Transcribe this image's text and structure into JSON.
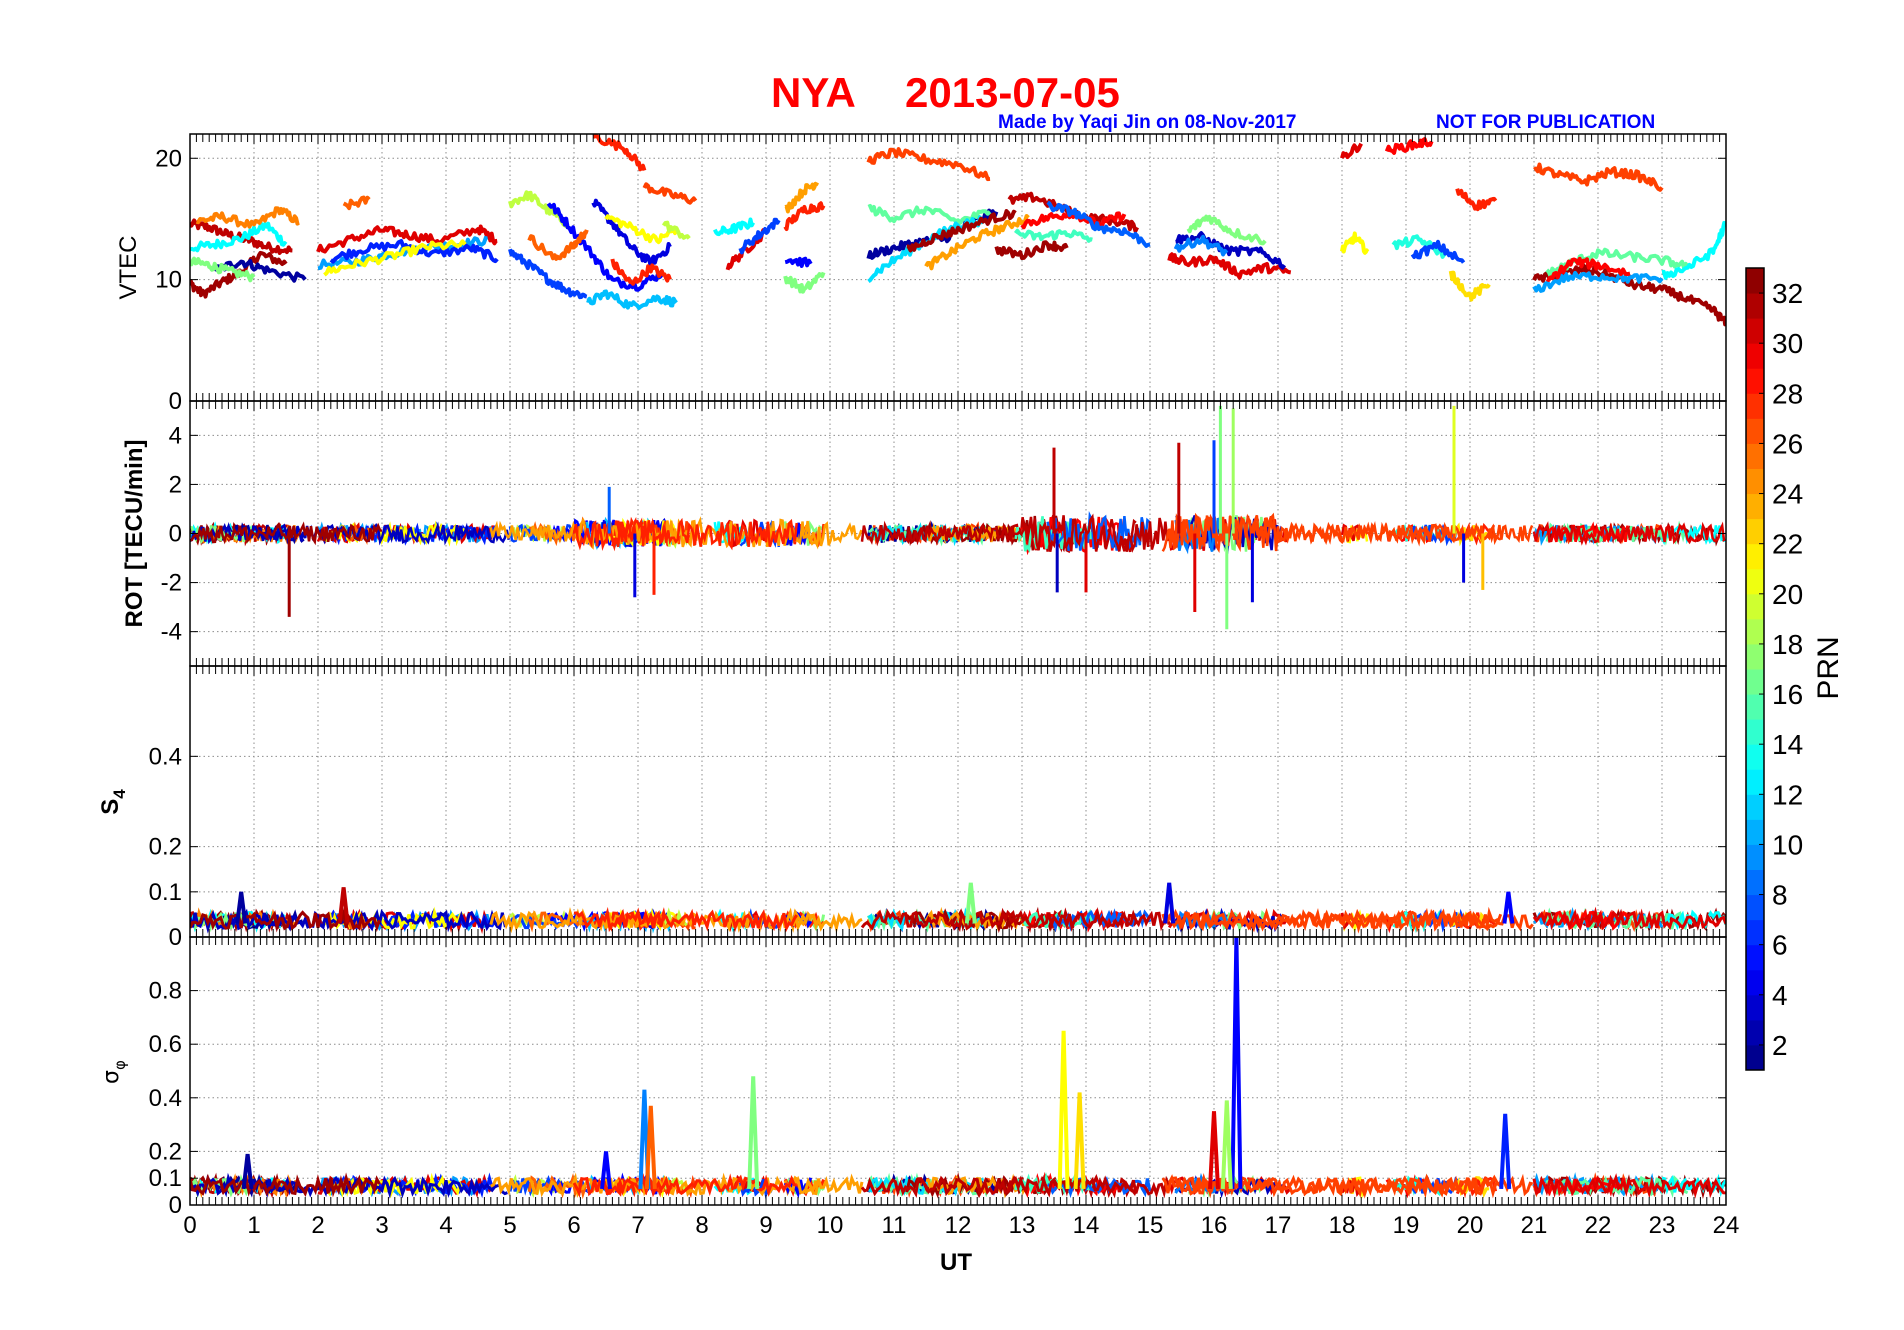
{
  "figure": {
    "title_station": "NYA",
    "title_date": "2013-07-05",
    "credit": "Made by Yaqi Jin on 08-Nov-2017",
    "notice": "NOT FOR PUBLICATION",
    "xlabel": "UT",
    "colorbar_label": "PRN",
    "colors": {
      "title": "#ff0000",
      "credit": "#0000ff",
      "axes": "#000000",
      "grid": "#8c8c8c"
    }
  },
  "chart_data": [
    {
      "type": "line",
      "panel": "VTEC",
      "ylabel": "VTEC",
      "xlim": [
        0,
        24
      ],
      "ylim": [
        0,
        22
      ],
      "yticks": [
        0,
        10,
        20
      ],
      "xticks": [
        0,
        1,
        2,
        3,
        4,
        5,
        6,
        7,
        8,
        9,
        10,
        11,
        12,
        13,
        14,
        15,
        16,
        17,
        18,
        19,
        20,
        21,
        22,
        23,
        24
      ],
      "grid": true,
      "series_summary": "one trace per PRN (1-32), coloured by PRN",
      "segments": [
        {
          "prn": 31,
          "x": [
            0.0,
            0.3,
            0.6,
            0.9,
            1.2,
            1.6
          ],
          "y": [
            14.6,
            14.3,
            13.7,
            13.3,
            12.7,
            12.4
          ]
        },
        {
          "prn": 32,
          "x": [
            0.0,
            0.2,
            0.5,
            0.8,
            1.1,
            1.5
          ],
          "y": [
            9.7,
            8.8,
            9.8,
            10.6,
            12.1,
            11.3
          ]
        },
        {
          "prn": 13,
          "x": [
            0.0,
            0.4,
            0.8,
            1.2,
            1.5
          ],
          "y": [
            12.6,
            12.9,
            13.4,
            14.5,
            12.9
          ]
        },
        {
          "prn": 25,
          "x": [
            0.1,
            0.5,
            1.0,
            1.4,
            1.7
          ],
          "y": [
            14.8,
            15.2,
            14.4,
            15.8,
            14.7
          ]
        },
        {
          "prn": 2,
          "x": [
            0.4,
            0.8,
            1.2,
            1.8
          ],
          "y": [
            10.8,
            11.5,
            10.8,
            10.0
          ]
        },
        {
          "prn": 17,
          "x": [
            0.0,
            0.3,
            0.6,
            1.0
          ],
          "y": [
            11.5,
            11.2,
            10.7,
            10.2
          ]
        },
        {
          "prn": 10,
          "x": [
            2.0,
            2.6,
            3.1,
            3.6,
            4.2,
            4.7
          ],
          "y": [
            11.2,
            11.5,
            12.1,
            12.6,
            12.9,
            13.3
          ]
        },
        {
          "prn": 30,
          "x": [
            2.0,
            2.5,
            3.0,
            3.4,
            3.9,
            4.5,
            4.8
          ],
          "y": [
            12.4,
            13.3,
            14.1,
            13.7,
            13.2,
            14.2,
            13.2
          ]
        },
        {
          "prn": 6,
          "x": [
            2.2,
            2.7,
            3.3,
            3.8,
            4.4,
            4.8
          ],
          "y": [
            11.7,
            12.5,
            12.9,
            12.1,
            12.6,
            11.7
          ]
        },
        {
          "prn": 21,
          "x": [
            2.1,
            2.6,
            3.2,
            3.7,
            4.3
          ],
          "y": [
            10.6,
            11.3,
            12.0,
            12.7,
            12.9
          ]
        },
        {
          "prn": 26,
          "x": [
            2.4,
            2.8
          ],
          "y": [
            16.0,
            16.6
          ]
        },
        {
          "prn": 19,
          "x": [
            5.0,
            5.3,
            5.6,
            5.9
          ],
          "y": [
            16.3,
            17.0,
            15.7,
            14.6
          ]
        },
        {
          "prn": 7,
          "x": [
            5.0,
            5.3,
            5.6,
            5.9,
            6.2
          ],
          "y": [
            12.3,
            11.2,
            10.0,
            9.1,
            8.6
          ]
        },
        {
          "prn": 5,
          "x": [
            5.6,
            5.9,
            6.3,
            6.6,
            7.0,
            7.4
          ],
          "y": [
            16.4,
            14.6,
            12.0,
            9.9,
            9.5,
            10.6
          ]
        },
        {
          "prn": 26,
          "x": [
            5.3,
            5.7,
            6.0,
            6.2
          ],
          "y": [
            13.5,
            11.7,
            12.8,
            14.1
          ]
        },
        {
          "prn": 11,
          "x": [
            6.2,
            6.5,
            6.9,
            7.3,
            7.6
          ],
          "y": [
            8.0,
            8.9,
            7.8,
            8.5,
            8.1
          ]
        },
        {
          "prn": 4,
          "x": [
            6.3,
            6.6,
            6.9,
            7.2,
            7.5
          ],
          "y": [
            16.4,
            14.7,
            12.6,
            11.4,
            12.7
          ]
        },
        {
          "prn": 21,
          "x": [
            6.5,
            6.9,
            7.3,
            7.6
          ],
          "y": [
            15.2,
            14.3,
            13.2,
            14.2
          ]
        },
        {
          "prn": 28,
          "x": [
            6.6,
            6.9,
            7.2,
            7.5
          ],
          "y": [
            11.4,
            9.6,
            11.0,
            10.0
          ]
        },
        {
          "prn": 28,
          "x": [
            6.3,
            6.8,
            7.1
          ],
          "y": [
            21.8,
            20.8,
            19.0
          ]
        },
        {
          "prn": 27,
          "x": [
            7.1,
            7.5,
            7.9
          ],
          "y": [
            17.7,
            17.0,
            16.5
          ]
        },
        {
          "prn": 19,
          "x": [
            7.4,
            7.8
          ],
          "y": [
            14.6,
            13.4
          ]
        },
        {
          "prn": 13,
          "x": [
            8.2,
            8.5,
            8.8
          ],
          "y": [
            13.8,
            14.2,
            14.7
          ]
        },
        {
          "prn": 30,
          "x": [
            8.4,
            8.7,
            9.0
          ],
          "y": [
            11.1,
            12.5,
            14.0
          ]
        },
        {
          "prn": 7,
          "x": [
            8.6,
            8.9,
            9.2
          ],
          "y": [
            12.5,
            13.7,
            14.9
          ]
        },
        {
          "prn": 17,
          "x": [
            9.3,
            9.6,
            9.9
          ],
          "y": [
            10.2,
            9.1,
            10.6
          ]
        },
        {
          "prn": 28,
          "x": [
            9.3,
            9.6,
            9.9
          ],
          "y": [
            14.4,
            15.8,
            16.1
          ]
        },
        {
          "prn": 24,
          "x": [
            9.3,
            9.6,
            9.8
          ],
          "y": [
            15.7,
            17.4,
            18.0
          ]
        },
        {
          "prn": 5,
          "x": [
            9.3,
            9.7
          ],
          "y": [
            11.7,
            11.3
          ]
        },
        {
          "prn": 27,
          "x": [
            10.6,
            11.0,
            11.5,
            12.0,
            12.5
          ],
          "y": [
            19.8,
            20.5,
            19.9,
            19.5,
            18.3
          ]
        },
        {
          "prn": 2,
          "x": [
            10.6,
            11.0,
            11.4,
            11.8,
            12.2,
            12.6
          ],
          "y": [
            12.0,
            12.6,
            13.1,
            13.4,
            14.7,
            15.6
          ]
        },
        {
          "prn": 16,
          "x": [
            10.6,
            11.0,
            11.5,
            12.0,
            12.5
          ],
          "y": [
            15.9,
            15.1,
            15.8,
            14.8,
            15.6
          ]
        },
        {
          "prn": 12,
          "x": [
            10.6,
            11.0,
            11.5,
            12.0,
            12.4
          ],
          "y": [
            10.2,
            11.6,
            13.2,
            14.5,
            14.9
          ]
        },
        {
          "prn": 32,
          "x": [
            11.2,
            11.6,
            12.0,
            12.5,
            12.9
          ],
          "y": [
            12.4,
            13.4,
            14.1,
            15.0,
            15.5
          ]
        },
        {
          "prn": 24,
          "x": [
            11.5,
            11.9,
            12.3,
            12.7,
            13.1
          ],
          "y": [
            11.0,
            12.3,
            13.5,
            14.3,
            15.1
          ]
        },
        {
          "prn": 32,
          "x": [
            12.6,
            13.0,
            13.4,
            13.7
          ],
          "y": [
            12.5,
            12.0,
            12.9,
            12.6
          ]
        },
        {
          "prn": 31,
          "x": [
            12.8,
            13.2,
            13.6,
            14.0,
            14.4,
            14.8
          ],
          "y": [
            16.5,
            16.8,
            15.9,
            15.1,
            14.9,
            14.3
          ]
        },
        {
          "prn": 29,
          "x": [
            13.0,
            13.4,
            13.8,
            14.2,
            14.6
          ],
          "y": [
            14.6,
            15.1,
            15.5,
            14.5,
            15.4
          ]
        },
        {
          "prn": 15,
          "x": [
            12.9,
            13.3,
            13.7,
            14.1
          ],
          "y": [
            13.8,
            13.5,
            13.9,
            13.3
          ]
        },
        {
          "prn": 8,
          "x": [
            13.4,
            13.8,
            14.2,
            14.6,
            15.0
          ],
          "y": [
            16.1,
            15.6,
            14.3,
            14.0,
            12.9
          ]
        },
        {
          "prn": 30,
          "x": [
            15.3,
            15.6,
            16.0,
            16.4,
            16.8,
            17.2
          ],
          "y": [
            11.8,
            11.4,
            11.7,
            10.5,
            11.0,
            10.6
          ]
        },
        {
          "prn": 17,
          "x": [
            15.6,
            15.9,
            16.3,
            16.8
          ],
          "y": [
            14.0,
            15.2,
            13.9,
            13.2
          ]
        },
        {
          "prn": 3,
          "x": [
            15.4,
            15.8,
            16.2,
            16.7,
            17.1
          ],
          "y": [
            13.3,
            13.5,
            12.4,
            12.3,
            11.2
          ]
        },
        {
          "prn": 9,
          "x": [
            15.4,
            15.8,
            16.2
          ],
          "y": [
            12.6,
            13.3,
            12.2
          ]
        },
        {
          "prn": 21,
          "x": [
            18.0,
            18.2,
            18.4
          ],
          "y": [
            12.4,
            13.5,
            12.3
          ]
        },
        {
          "prn": 30,
          "x": [
            18.0,
            18.3
          ],
          "y": [
            20.0,
            21.2
          ]
        },
        {
          "prn": 29,
          "x": [
            18.7,
            19.1,
            19.4
          ],
          "y": [
            20.6,
            21.1,
            21.4
          ]
        },
        {
          "prn": 14,
          "x": [
            18.8,
            19.2,
            19.6
          ],
          "y": [
            12.8,
            13.3,
            12.1
          ]
        },
        {
          "prn": 7,
          "x": [
            19.1,
            19.5,
            19.9
          ],
          "y": [
            11.9,
            12.8,
            11.4
          ]
        },
        {
          "prn": 28,
          "x": [
            19.8,
            20.1,
            20.4
          ],
          "y": [
            17.3,
            16.1,
            16.5
          ]
        },
        {
          "prn": 22,
          "x": [
            19.7,
            20.0,
            20.3
          ],
          "y": [
            10.5,
            8.6,
            9.6
          ]
        },
        {
          "prn": 27,
          "x": [
            21.0,
            21.4,
            21.8,
            22.2,
            22.6,
            23.0
          ],
          "y": [
            19.3,
            18.6,
            18.1,
            18.9,
            18.6,
            17.6
          ]
        },
        {
          "prn": 32,
          "x": [
            21.0,
            21.4,
            21.8,
            22.2,
            22.6,
            23.0,
            23.4,
            23.8,
            24.0
          ],
          "y": [
            10.0,
            10.4,
            10.9,
            10.3,
            9.5,
            9.2,
            8.4,
            7.5,
            6.4
          ]
        },
        {
          "prn": 10,
          "x": [
            21.0,
            21.5,
            22.0,
            22.5,
            23.0
          ],
          "y": [
            9.1,
            10.2,
            10.3,
            10.1,
            10.1
          ]
        },
        {
          "prn": 16,
          "x": [
            21.2,
            21.6,
            22.0,
            22.5,
            23.0,
            23.4
          ],
          "y": [
            10.5,
            11.4,
            12.2,
            11.9,
            11.6,
            11.1
          ]
        },
        {
          "prn": 13,
          "x": [
            23.0,
            23.4,
            23.8,
            24.0
          ],
          "y": [
            10.3,
            11.0,
            12.3,
            14.7
          ]
        },
        {
          "prn": 29,
          "x": [
            21.2,
            21.6,
            22.0,
            22.5
          ],
          "y": [
            9.8,
            11.5,
            11.2,
            10.5
          ]
        }
      ]
    },
    {
      "type": "line",
      "panel": "ROT",
      "ylabel": "ROT [TECU/min]",
      "xlim": [
        0,
        24
      ],
      "ylim": [
        -5.4,
        5.4
      ],
      "yticks": [
        -4,
        -2,
        0,
        2,
        4
      ],
      "grid": true,
      "spikes": [
        {
          "prn": 32,
          "x": 1.55,
          "y": -3.4
        },
        {
          "prn": 8,
          "x": 6.55,
          "y": 1.9
        },
        {
          "prn": 4,
          "x": 6.95,
          "y": -2.6
        },
        {
          "prn": 28,
          "x": 7.25,
          "y": -2.5
        },
        {
          "prn": 31,
          "x": 13.5,
          "y": 3.5
        },
        {
          "prn": 3,
          "x": 13.55,
          "y": -2.4
        },
        {
          "prn": 30,
          "x": 14.0,
          "y": -2.4
        },
        {
          "prn": 31,
          "x": 15.45,
          "y": 3.7
        },
        {
          "prn": 30,
          "x": 15.7,
          "y": -3.2
        },
        {
          "prn": 7,
          "x": 16.0,
          "y": 3.8
        },
        {
          "prn": 17,
          "x": 16.1,
          "y": 5.2
        },
        {
          "prn": 17,
          "x": 16.2,
          "y": -3.9
        },
        {
          "prn": 18,
          "x": 16.3,
          "y": 5.1
        },
        {
          "prn": 4,
          "x": 16.6,
          "y": -2.8
        },
        {
          "prn": 20,
          "x": 19.75,
          "y": 5.2
        },
        {
          "prn": 4,
          "x": 19.9,
          "y": -2.0
        },
        {
          "prn": 23,
          "x": 20.2,
          "y": -2.3
        }
      ]
    },
    {
      "type": "line",
      "panel": "S4",
      "ylabel": "S4",
      "xlim": [
        0,
        24
      ],
      "ylim": [
        0,
        0.6
      ],
      "yticks": [
        0,
        0.1,
        0.2,
        0.4
      ],
      "grid": true,
      "peaks": [
        {
          "prn": 2,
          "x": 0.8,
          "y": 0.1
        },
        {
          "prn": 31,
          "x": 2.4,
          "y": 0.11
        },
        {
          "prn": 4,
          "x": 15.3,
          "y": 0.12
        },
        {
          "prn": 17,
          "x": 12.2,
          "y": 0.12
        },
        {
          "prn": 5,
          "x": 20.6,
          "y": 0.1
        }
      ],
      "baseline": 0.03
    },
    {
      "type": "line",
      "panel": "sigma_phi",
      "ylabel": "σφ",
      "xlim": [
        0,
        24
      ],
      "ylim": [
        0,
        1.0
      ],
      "yticks": [
        0,
        0.1,
        0.2,
        0.4,
        0.6,
        0.8
      ],
      "grid": true,
      "peaks": [
        {
          "prn": 2,
          "x": 0.9,
          "y": 0.19
        },
        {
          "prn": 9,
          "x": 7.1,
          "y": 0.43
        },
        {
          "prn": 26,
          "x": 7.2,
          "y": 0.37
        },
        {
          "prn": 17,
          "x": 8.8,
          "y": 0.48
        },
        {
          "prn": 21,
          "x": 13.65,
          "y": 0.65
        },
        {
          "prn": 22,
          "x": 13.9,
          "y": 0.42
        },
        {
          "prn": 5,
          "x": 16.35,
          "y": 1.0
        },
        {
          "prn": 18,
          "x": 16.2,
          "y": 0.39
        },
        {
          "prn": 30,
          "x": 16.0,
          "y": 0.35
        },
        {
          "prn": 6,
          "x": 20.55,
          "y": 0.34
        },
        {
          "prn": 5,
          "x": 6.5,
          "y": 0.2
        }
      ],
      "baseline": 0.06
    }
  ],
  "colorbar": {
    "label": "PRN",
    "min": 1,
    "max": 33,
    "ticks": [
      2,
      4,
      6,
      8,
      10,
      12,
      14,
      16,
      18,
      20,
      22,
      24,
      26,
      28,
      30,
      32
    ],
    "colormap": "jet"
  }
}
